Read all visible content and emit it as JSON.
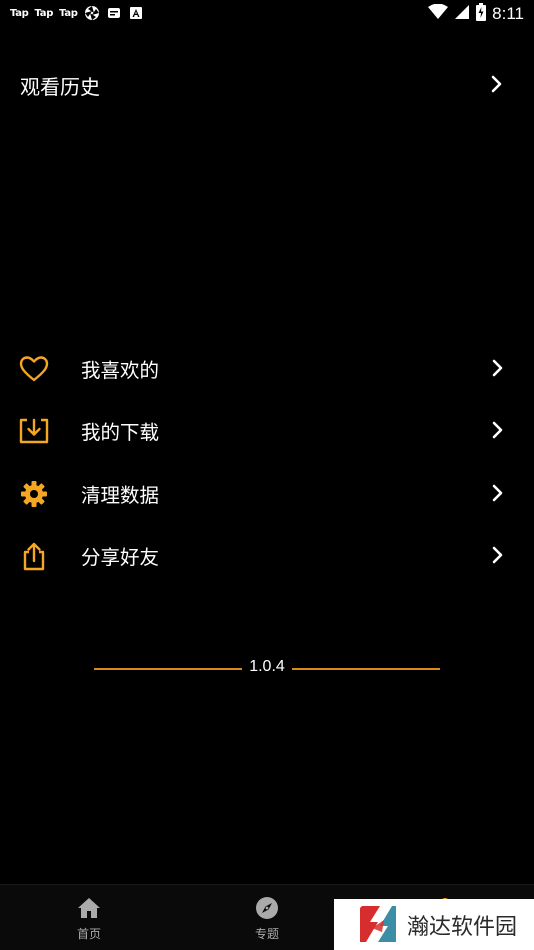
{
  "status_bar": {
    "left_icons": [
      "Tap",
      "Tap",
      "Tap"
    ],
    "time": "8:11",
    "battery_indicator": "charging"
  },
  "history": {
    "title": "观看历史"
  },
  "menu": {
    "items": [
      {
        "label": "我喜欢的",
        "icon": "heart-icon"
      },
      {
        "label": "我的下载",
        "icon": "download-icon"
      },
      {
        "label": "清理数据",
        "icon": "gear-icon"
      },
      {
        "label": "分享好友",
        "icon": "share-icon"
      }
    ]
  },
  "version": "1.0.4",
  "bottom_nav": {
    "items": [
      {
        "label": "首页",
        "icon": "home-icon"
      },
      {
        "label": "专题",
        "icon": "compass-icon"
      }
    ]
  },
  "watermark": {
    "text": "瀚达软件园"
  },
  "colors": {
    "accent": "#f5a623",
    "background": "#000000",
    "divider": "#d98a12"
  }
}
